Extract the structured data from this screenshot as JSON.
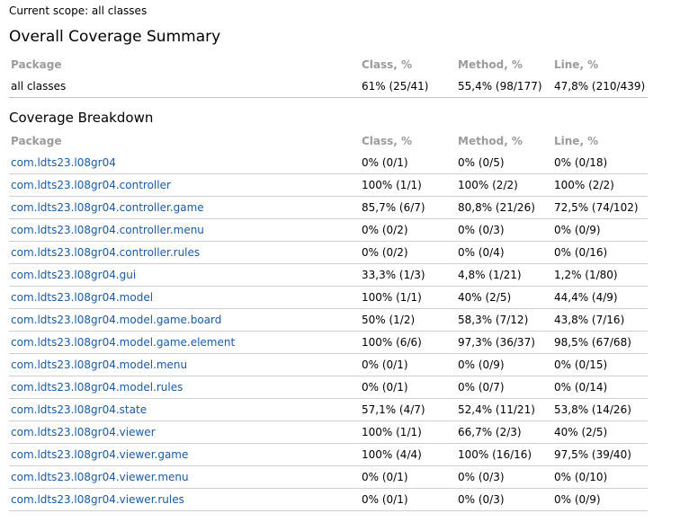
{
  "scope_text": "Current scope: all classes",
  "summary": {
    "title": "Overall Coverage Summary",
    "headers": [
      "Package",
      "Class, %",
      "Method, %",
      "Line, %"
    ],
    "row": {
      "package": "all classes",
      "class": "61% (25/41)",
      "method": "55,4% (98/177)",
      "line": "47,8% (210/439)"
    }
  },
  "breakdown": {
    "title": "Coverage Breakdown",
    "headers": [
      "Package",
      "Class, %",
      "Method, %",
      "Line, %"
    ],
    "rows": [
      {
        "package": "com.ldts23.l08gr04",
        "class": "0% (0/1)",
        "method": "0% (0/5)",
        "line": "0% (0/18)"
      },
      {
        "package": "com.ldts23.l08gr04.controller",
        "class": "100% (1/1)",
        "method": "100% (2/2)",
        "line": "100% (2/2)"
      },
      {
        "package": "com.ldts23.l08gr04.controller.game",
        "class": "85,7% (6/7)",
        "method": "80,8% (21/26)",
        "line": "72,5% (74/102)"
      },
      {
        "package": "com.ldts23.l08gr04.controller.menu",
        "class": "0% (0/2)",
        "method": "0% (0/3)",
        "line": "0% (0/9)"
      },
      {
        "package": "com.ldts23.l08gr04.controller.rules",
        "class": "0% (0/2)",
        "method": "0% (0/4)",
        "line": "0% (0/16)"
      },
      {
        "package": "com.ldts23.l08gr04.gui",
        "class": "33,3% (1/3)",
        "method": "4,8% (1/21)",
        "line": "1,2% (1/80)"
      },
      {
        "package": "com.ldts23.l08gr04.model",
        "class": "100% (1/1)",
        "method": "40% (2/5)",
        "line": "44,4% (4/9)"
      },
      {
        "package": "com.ldts23.l08gr04.model.game.board",
        "class": "50% (1/2)",
        "method": "58,3% (7/12)",
        "line": "43,8% (7/16)"
      },
      {
        "package": "com.ldts23.l08gr04.model.game.element",
        "class": "100% (6/6)",
        "method": "97,3% (36/37)",
        "line": "98,5% (67/68)"
      },
      {
        "package": "com.ldts23.l08gr04.model.menu",
        "class": "0% (0/1)",
        "method": "0% (0/9)",
        "line": "0% (0/15)"
      },
      {
        "package": "com.ldts23.l08gr04.model.rules",
        "class": "0% (0/1)",
        "method": "0% (0/7)",
        "line": "0% (0/14)"
      },
      {
        "package": "com.ldts23.l08gr04.state",
        "class": "57,1% (4/7)",
        "method": "52,4% (11/21)",
        "line": "53,8% (14/26)"
      },
      {
        "package": "com.ldts23.l08gr04.viewer",
        "class": "100% (1/1)",
        "method": "66,7% (2/3)",
        "line": "40% (2/5)"
      },
      {
        "package": "com.ldts23.l08gr04.viewer.game",
        "class": "100% (4/4)",
        "method": "100% (16/16)",
        "line": "97,5% (39/40)"
      },
      {
        "package": "com.ldts23.l08gr04.viewer.menu",
        "class": "0% (0/1)",
        "method": "0% (0/3)",
        "line": "0% (0/10)"
      },
      {
        "package": "com.ldts23.l08gr04.viewer.rules",
        "class": "0% (0/1)",
        "method": "0% (0/3)",
        "line": "0% (0/9)"
      }
    ]
  },
  "colors": {
    "link": "#1a5aa6",
    "header_text": "#9b9b9b",
    "row_border": "#cfcfcf"
  }
}
